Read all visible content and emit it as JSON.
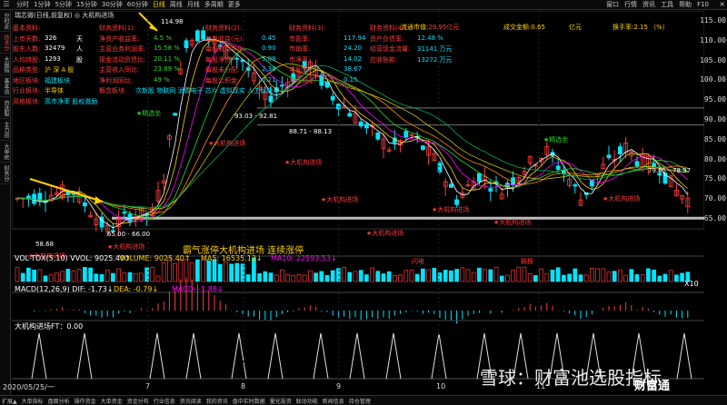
{
  "topbar": {
    "periods": [
      "分时",
      "1分钟",
      "5分钟",
      "15分钟",
      "30分钟",
      "60分钟",
      "日线",
      "周线",
      "月线",
      "多周期",
      "更多"
    ],
    "active_period": "日线",
    "right_menu": [
      "窗口",
      "行情",
      "资讯",
      "工具",
      "帮助",
      "F10"
    ],
    "close_label": "×"
  },
  "leftbar": {
    "tabs": [
      "分时走势",
      "技术分析",
      "大盘指标",
      "基本资料",
      "自选股",
      "主力资金",
      "大单统计",
      "财务分析"
    ],
    "active": "技术分析"
  },
  "stock": {
    "title": "瑞芯微(日线,前复权) ◎ 大机构进场"
  },
  "info": {
    "basic": [
      {
        "label": "基本资料:",
        "value": "",
        "unit": ""
      },
      {
        "label": "上市天数:",
        "value": "326",
        "unit": "天"
      },
      {
        "label": "股东人数:",
        "value": "32479",
        "unit": "人"
      },
      {
        "label": "人均持股:",
        "value": "1293",
        "unit": "股"
      },
      {
        "label": "品种类型:",
        "value": "沪 深 A 股",
        "unit": ""
      },
      {
        "label": "地区板块:",
        "value": "福建板块",
        "unit": ""
      },
      {
        "label": "行业板块:",
        "value": "半导体",
        "unit": ""
      },
      {
        "label": "风格板块:",
        "value": "高市净率 股权激励",
        "unit": ""
      }
    ],
    "finance1": [
      {
        "label": "财务资料(1):",
        "value": ""
      },
      {
        "label": "净资产收益率:",
        "value": "4.5 %"
      },
      {
        "label": "主营业务利润率:",
        "value": "15.58 %"
      },
      {
        "label": "现金流动负债比:",
        "value": "20.11 %"
      },
      {
        "label": "主营收入同比:",
        "value": "23.89 %"
      },
      {
        "label": "净利润同比:",
        "value": "49 %"
      },
      {
        "label": "概念板块:",
        "value": "次新股 物联网 消费电子 芯片 虚拟现实 人工智能"
      }
    ],
    "finance2": [
      {
        "label": "财务资料(2):",
        "value": ""
      },
      {
        "label": "每股收益(元):",
        "value": "0.45"
      },
      {
        "label": "每股收益年化:",
        "value": "0.90"
      },
      {
        "label": "每股净资产:",
        "value": "5.09"
      },
      {
        "label": "每股未分配:",
        "value": "2.38"
      },
      {
        "label": "每股公积金:",
        "value": "0.21"
      }
    ],
    "finance3": [
      {
        "label": "财务资料(3):",
        "value": ""
      },
      {
        "label": "市盈率:",
        "value": "117.94"
      },
      {
        "label": "市销率:",
        "value": "24.20"
      },
      {
        "label": "市净率:",
        "value": "14.02"
      },
      {
        "label": "毛利率:",
        "value": "38.67"
      },
      {
        "label": "净利润率:",
        "value": "0.15"
      }
    ],
    "finance4": [
      {
        "label": "财务资料(4):",
        "value": ""
      },
      {
        "label": "资产负债率:",
        "value": "12.48 %"
      },
      {
        "label": "经营现金流量:",
        "value": "31141 万元"
      },
      {
        "label": "应收账款:",
        "value": "13272 万元"
      }
    ],
    "market": [
      {
        "label": "流通市值:",
        "value": "29.95亿元"
      },
      {
        "label": "成交金额:",
        "value": "0.65"
      },
      {
        "label": "",
        "value": "亿元"
      },
      {
        "label": "换手率:",
        "value": "2.15 （%）"
      }
    ]
  },
  "price_axis": {
    "ticks": [
      "115.00",
      "110.00",
      "105.00",
      "100.00",
      "95.00",
      "90.00",
      "85.00",
      "80.00",
      "75.00",
      "70.00",
      "65.00"
    ]
  },
  "annotations": {
    "high": "114.98",
    "low": "58.68",
    "range1": "93.03 - 92.81",
    "range2": "88.71 - 88.13",
    "range3": "79.65 - 78.97",
    "range4": "65.00 - 66.00",
    "signal": "★大机构进场",
    "limit_up": "★精选坐",
    "main_caption": "霸气涨停大机构进场 连续涨停",
    "small_red": "闪电",
    "small_red2": "摘板"
  },
  "volume_panel": {
    "title": "VOL-TDX(5,10) VVOL: 9025.40↑",
    "vol": "VOLUME: 9025.40↑",
    "ma5": "MA5: 16535.13↓",
    "ma10": "MA10: 22593.53↓",
    "axis_label": "X10"
  },
  "macd_panel": {
    "title": "MACD(12,26,9) DIF: -1.73↓",
    "dea": "DEA: -0.79↓",
    "macd": "MACD: -1.88↓"
  },
  "ft_panel": {
    "title": "大机构进场FT：0.00"
  },
  "dates": {
    "first": "2020/05/25/一",
    "months": [
      "7",
      "8",
      "9",
      "10",
      "11"
    ]
  },
  "bottombar": {
    "items": [
      "扩展▲",
      "大单指标",
      "盘面分析",
      "操作资金",
      "大单资金",
      "资金分布",
      "行业信息",
      "资讯阅读",
      "我的资讯",
      "盘中实时数据",
      "量化投资",
      "联动功能",
      "新闻信息",
      "持仓管理"
    ]
  },
  "watermark": {
    "text": "雪球：财富池选股指标",
    "brand": "财富通"
  },
  "chart_data": {
    "type": "candlestick",
    "ylim": [
      58,
      118
    ],
    "candles_hint": "daily candlesticks from 2020-05 to 2020-11 with peak 114.98 in July and low 58.68 in June"
  },
  "colors": {
    "up": "#ff3b3b",
    "down": "#00e5ff",
    "ma1": "#ffffff",
    "ma2": "#ffd000",
    "ma3": "#ff00ff",
    "ma4": "#29d829",
    "ma5": "#ff8c00"
  }
}
